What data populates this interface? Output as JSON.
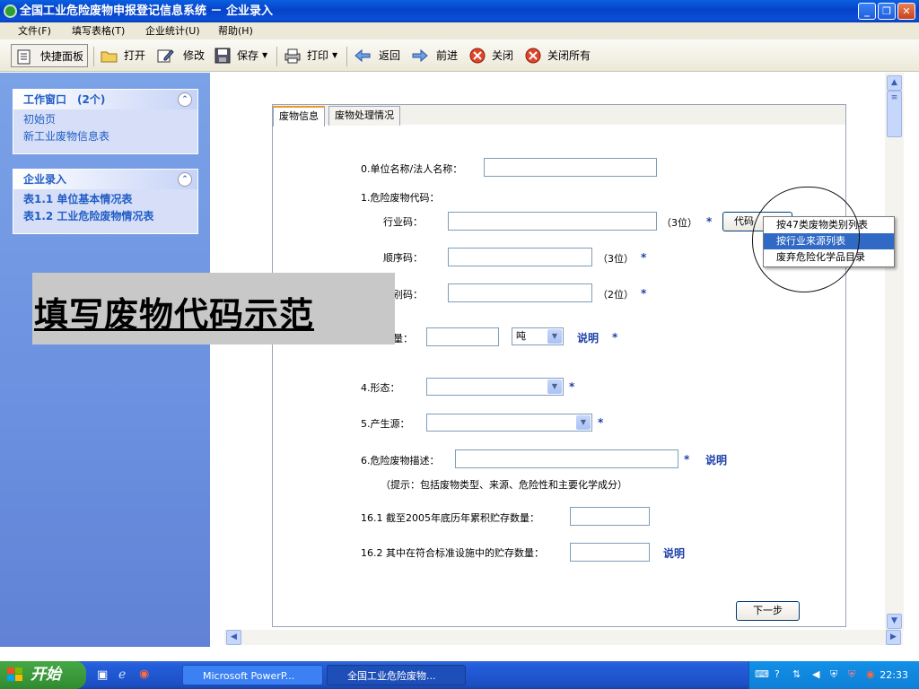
{
  "window": {
    "title": "全国工业危险废物申报登记信息系统 － 企业录入"
  },
  "menu": [
    "文件(F)",
    "填写表格(T)",
    "企业统计(U)",
    "帮助(H)"
  ],
  "toolbar": {
    "quick_panel": "快捷面板",
    "open": "打开",
    "edit": "修改",
    "save": "保存",
    "print": "打印",
    "back": "返回",
    "forward": "前进",
    "close": "关闭",
    "close_all": "关闭所有"
  },
  "sidebar": {
    "work_window": {
      "title": "工作窗口　(2个)",
      "items": [
        "初始页",
        "新工业废物信息表"
      ]
    },
    "enterprise": {
      "title": "企业录入",
      "items": [
        "表1.1 单位基本情况表",
        "表1.2 工业危险废物情况表"
      ]
    }
  },
  "tabs": [
    "废物信息",
    "废物处理情况"
  ],
  "form": {
    "unit_name": "0.单位名称/法人名称：",
    "hw_code": "1.危险废物代码：",
    "industry_code": "行业码：",
    "industry_hint": "（3位）",
    "seq_code": "顺序码：",
    "seq_hint": "（3位）",
    "category_code": "别码：",
    "category_hint": "（2位）",
    "quantity": "量：",
    "unit_value": "吨",
    "state": "4.形态：",
    "source": "5.产生源：",
    "description": "6.危险废物描述：",
    "desc_hint": "（提示：包括废物类型、来源、危险性和主要化学成分）",
    "stock_2005": "16.1 截至2005年底历年累积贮存数量：",
    "stock_standard": "16.2 其中在符合标准设施中的贮存数量：",
    "note": "说明",
    "star": "*",
    "code_button": "代码",
    "next": "下一步"
  },
  "context_menu": [
    "按47类废物类别列表",
    "按行业来源列表",
    "废弃危险化学品目录"
  ],
  "banner": "填写废物代码示范",
  "taskbar": {
    "start": "开始",
    "tasks": [
      "Microsoft PowerP...",
      "全国工业危险废物..."
    ],
    "clock": "22:33"
  }
}
